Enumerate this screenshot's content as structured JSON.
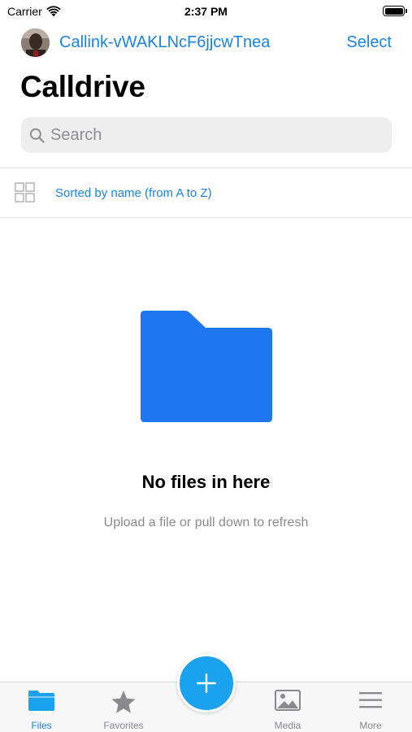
{
  "status_bar": {
    "carrier": "Carrier",
    "time": "2:37 PM",
    "wifi_icon": "wifi-icon",
    "battery_icon": "battery-icon"
  },
  "header": {
    "account_name": "Callink-vWAKLNcF6jjcwTnea",
    "select_label": "Select",
    "title": "Calldrive"
  },
  "search": {
    "placeholder": "Search",
    "value": ""
  },
  "sort": {
    "label": "Sorted by name (from A to Z)",
    "view_icon": "grid-view-icon"
  },
  "empty_state": {
    "icon": "folder-icon",
    "title": "No files in here",
    "subtitle": "Upload a file or pull down to refresh"
  },
  "tab_bar": {
    "tabs": [
      {
        "label": "Files",
        "icon": "folder-icon",
        "active": true
      },
      {
        "label": "Favorites",
        "icon": "star-icon",
        "active": false
      },
      {
        "label": "Media",
        "icon": "photo-icon",
        "active": false
      },
      {
        "label": "More",
        "icon": "menu-icon",
        "active": false
      }
    ],
    "add_icon": "plus-icon"
  },
  "colors": {
    "accent": "#1a84e6",
    "folder": "#1f76f2",
    "fab": "#1ba2ef",
    "secondary_text": "#8a8a8e"
  }
}
